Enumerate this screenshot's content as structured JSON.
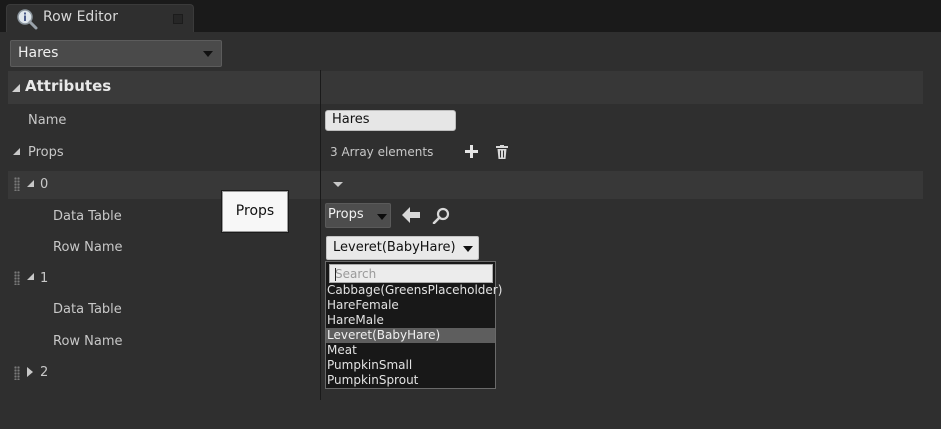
{
  "tab": {
    "title": "Row Editor",
    "icon": "info-magnifier-icon"
  },
  "row_select": {
    "value": "Hares"
  },
  "details": {
    "section_title": "Attributes",
    "name": {
      "label": "Name",
      "value": "Hares"
    },
    "props": {
      "label": "Props",
      "summary": "3 Array elements",
      "add_icon": "plus-icon",
      "delete_icon": "trash-icon"
    },
    "elements": [
      {
        "index": "0",
        "expanded": true,
        "data_table_label": "Data Table",
        "data_table_value": "Props",
        "row_name_label": "Row Name",
        "row_name_value": "Leveret(BabyHare)"
      },
      {
        "index": "1",
        "expanded": true,
        "data_table_label": "Data Table",
        "row_name_label": "Row Name"
      },
      {
        "index": "2",
        "expanded": false
      }
    ]
  },
  "tooltip": {
    "text": "Props"
  },
  "dropdown": {
    "search_placeholder": "Search",
    "options": [
      "Cabbage(GreensPlaceholder)",
      "HareFemale",
      "HareMale",
      "Leveret(BabyHare)",
      "Meat",
      "PumpkinSmall",
      "PumpkinSprout"
    ],
    "selected": "Leveret(BabyHare)"
  },
  "colors": {
    "panel": "#2f2f2f",
    "background": "#1a1a1a",
    "selected_item": "#5e5e5e"
  }
}
